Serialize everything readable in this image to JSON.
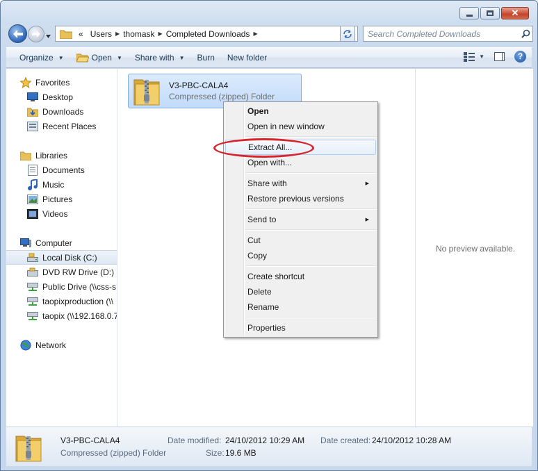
{
  "window": {
    "caption": {
      "minimize": "",
      "maximize": "",
      "close": "✕"
    }
  },
  "navbar": {
    "breadcrumb": [
      "«",
      "Users",
      "thomask",
      "Completed Downloads"
    ],
    "search_placeholder": "Search Completed Downloads"
  },
  "toolbar": {
    "organize": "Organize",
    "open": "Open",
    "share_with": "Share with",
    "burn": "Burn",
    "new_folder": "New folder",
    "help": "?"
  },
  "sidebar": {
    "favorites": {
      "label": "Favorites",
      "items": [
        "Desktop",
        "Downloads",
        "Recent Places"
      ]
    },
    "libraries": {
      "label": "Libraries",
      "items": [
        "Documents",
        "Music",
        "Pictures",
        "Videos"
      ]
    },
    "computer": {
      "label": "Computer",
      "items": [
        "Local Disk (C:)",
        "DVD RW Drive (D:) C",
        "Public Drive (\\\\css-s",
        "taopixproduction (\\\\",
        "taopix (\\\\192.168.0.7"
      ]
    },
    "network": {
      "label": "Network"
    }
  },
  "file": {
    "name": "V3-PBC-CALA4",
    "type": "Compressed (zipped) Folder"
  },
  "context_menu": {
    "items": [
      "Open",
      "Open in new window",
      "Extract All...",
      "Open with...",
      "Share with",
      "Restore previous versions",
      "Send to",
      "Cut",
      "Copy",
      "Create shortcut",
      "Delete",
      "Rename",
      "Properties"
    ]
  },
  "preview": {
    "text": "No preview available."
  },
  "details": {
    "name": "V3-PBC-CALA4",
    "type": "Compressed (zipped) Folder",
    "modified_label": "Date modified:",
    "modified_value": "24/10/2012 10:29 AM",
    "created_label": "Date created:",
    "created_value": "24/10/2012 10:28 AM",
    "size_label": "Size:",
    "size_value": "19.6 MB"
  },
  "colors": {
    "selection": "#c1dbfb",
    "annotation_ring": "#d8242a",
    "window_frame": "#cfdeef"
  }
}
